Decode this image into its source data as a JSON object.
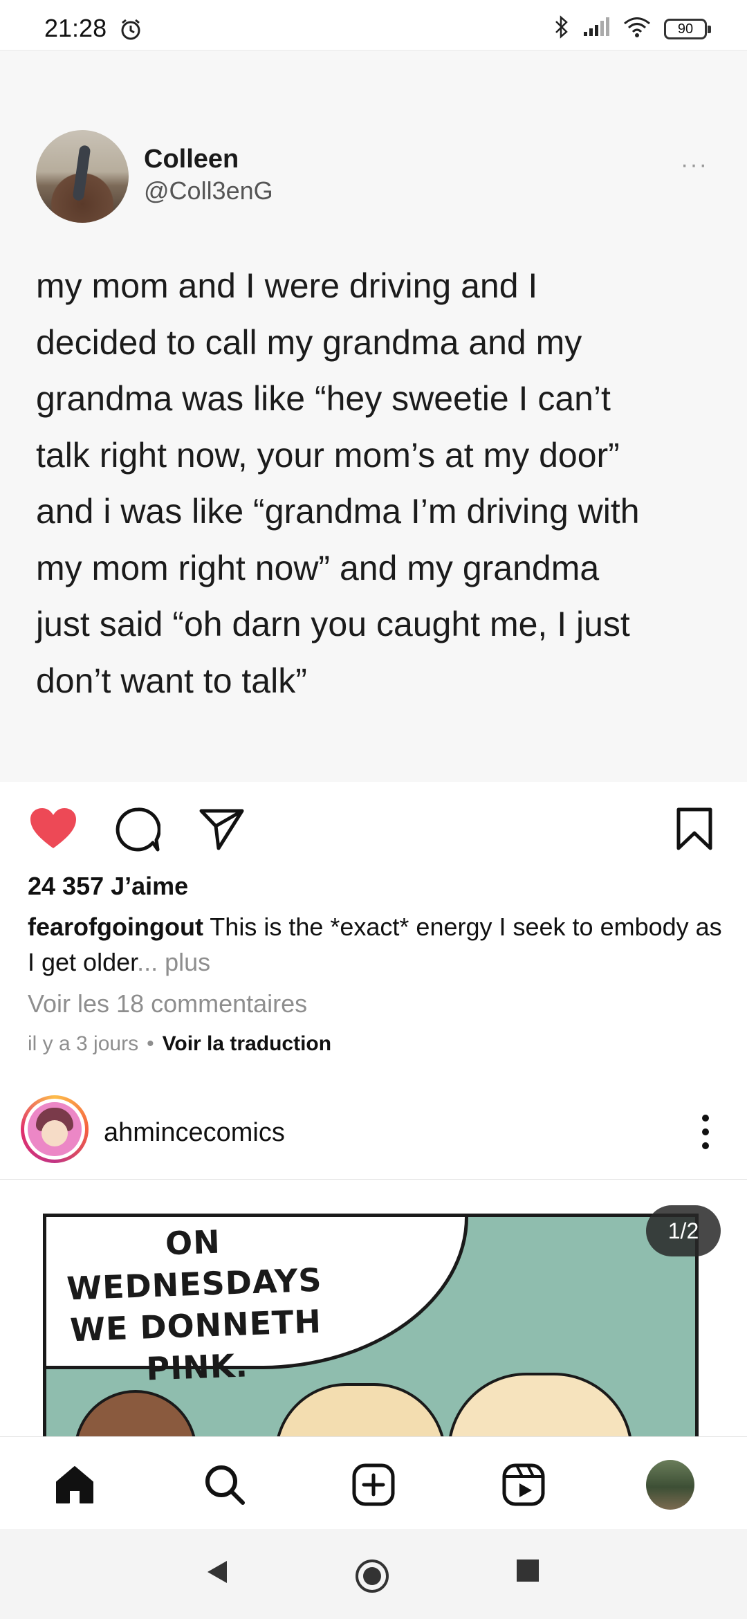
{
  "status_bar": {
    "time": "21:28",
    "battery": "90",
    "icons": [
      "alarm-icon",
      "bluetooth-icon",
      "signal-icon",
      "wifi-icon",
      "battery-icon"
    ]
  },
  "tweet": {
    "display_name": "Colleen",
    "handle": "@Coll3enG",
    "more": "···",
    "text": "my mom and I were driving and I\ndecided to call my grandma and my\ngrandma was like “hey sweetie I can’t\ntalk right now, your mom’s at my door”\nand i was like “grandma I’m driving with\nmy mom right now” and my grandma\njust said “oh darn you caught me, I just\ndon’t want to talk”"
  },
  "post": {
    "likes": "24 357 J’aime",
    "caption_user": "fearofgoingout",
    "caption_text": " This is the *exact* energy I seek to embody as I get older",
    "caption_more": "... plus",
    "comments": "Voir les 18 commentaires",
    "time_ago": "il y a 3 jours",
    "separator": "•",
    "translate": "Voir la traduction",
    "liked": true,
    "colors": {
      "like": "#ed4956",
      "muted": "#8e8e8e"
    }
  },
  "next_post": {
    "username": "ahmincecomics",
    "pager": "1/2",
    "comic_text": "ON WEDNESDAYS\nWE DONNETH\nPINK."
  },
  "bottom_nav": {
    "items": [
      "home-icon",
      "search-icon",
      "create-icon",
      "reels-icon",
      "profile-avatar"
    ]
  },
  "system_nav": {
    "items": [
      "back-icon",
      "home-circle-icon",
      "recents-icon"
    ]
  }
}
